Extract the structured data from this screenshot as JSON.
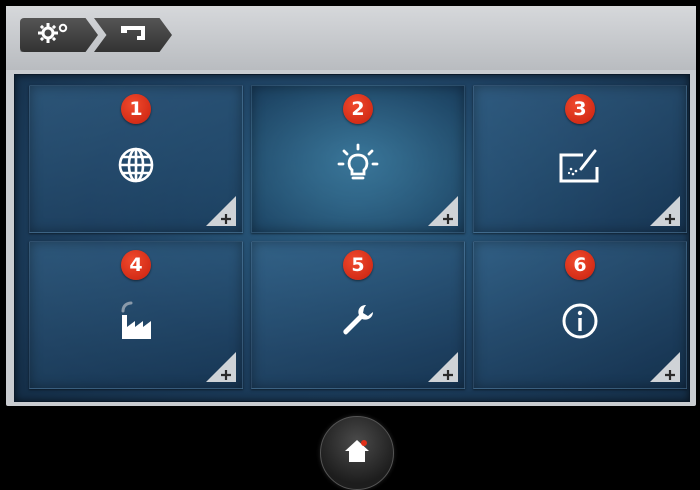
{
  "breadcrumb": [
    {
      "icon": "settings-icon"
    },
    {
      "icon": "sewing-machine-icon"
    }
  ],
  "tiles": [
    {
      "number": "1",
      "icon": "globe-icon"
    },
    {
      "number": "2",
      "icon": "lightbulb-icon"
    },
    {
      "number": "3",
      "icon": "touchscreen-calibration-icon"
    },
    {
      "number": "4",
      "icon": "factory-icon"
    },
    {
      "number": "5",
      "icon": "wrench-icon"
    },
    {
      "number": "6",
      "icon": "info-icon"
    }
  ],
  "footer": {
    "home_icon": "home-icon"
  },
  "colors": {
    "badge": "#e0311a",
    "panel": "#1d3f5f",
    "topbar": "#c9ccd0"
  }
}
